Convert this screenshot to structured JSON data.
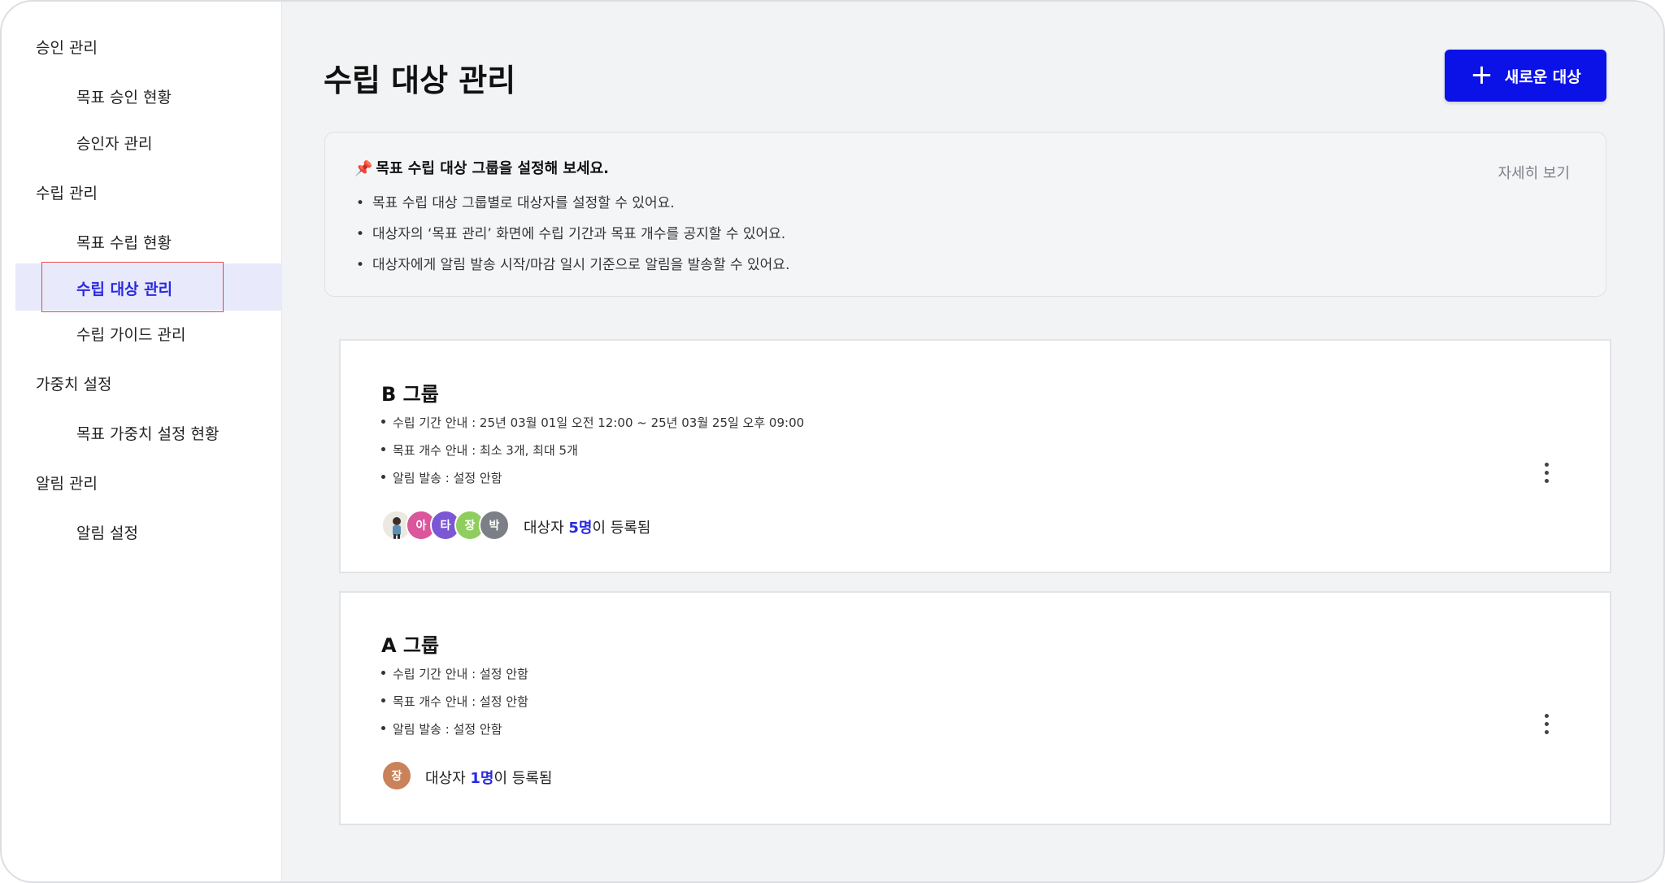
{
  "sidebar": {
    "sections": [
      {
        "label": "승인 관리",
        "items": [
          "목표 승인 현황",
          "승인자 관리"
        ]
      },
      {
        "label": "수립 관리",
        "items": [
          "목표 수립 현황",
          "수립 대상 관리",
          "수립 가이드 관리"
        ]
      },
      {
        "label": "가중치 설정",
        "items": [
          "목표 가중치 설정 현황"
        ]
      },
      {
        "label": "알림 관리",
        "items": [
          "알림 설정"
        ]
      }
    ],
    "active_item": "수립 대상 관리"
  },
  "header": {
    "title": "수립 대상 관리",
    "new_button_label": "새로운 대상"
  },
  "info": {
    "title": "목표 수립 대상 그룹을 설정해 보세요.",
    "lines": [
      "목표 수립 대상 그룹별로 대상자를 설정할 수 있어요.",
      "대상자의 ‘목표 관리’ 화면에 수립 기간과 목표 개수를 공지할 수 있어요.",
      "대상자에게 알림 발송 시작/마감 일시 기준으로 알림을 발송할 수 있어요."
    ],
    "detail_link": "자세히 보기"
  },
  "groups": [
    {
      "title": "B 그룹",
      "lines": [
        "수립 기간 안내 : 25년 03월 01일 오전 12:00 ~ 25년 03월 25일 오후 09:00",
        "목표 개수 안내 : 최소 3개, 최대 5개",
        "알림 발송 : 설정 안함"
      ],
      "avatars": [
        {
          "initial": "",
          "color": "#e8e3dc",
          "type": "photo"
        },
        {
          "initial": "아",
          "color": "#d9579a"
        },
        {
          "initial": "타",
          "color": "#7b57d4"
        },
        {
          "initial": "장",
          "color": "#8fce5e"
        },
        {
          "initial": "박",
          "color": "#7c7f86"
        }
      ],
      "reg_prefix": "대상자 ",
      "reg_count": "5명",
      "reg_suffix": "이 등록됨"
    },
    {
      "title": "A 그룹",
      "lines": [
        "수립 기간 안내 : 설정 안함",
        "목표 개수 안내 : 설정 안함",
        "알림 발송 : 설정 안함"
      ],
      "avatars": [
        {
          "initial": "장",
          "color": "#c9825a"
        }
      ],
      "reg_prefix": "대상자 ",
      "reg_count": "1명",
      "reg_suffix": "이 등록됨"
    }
  ]
}
